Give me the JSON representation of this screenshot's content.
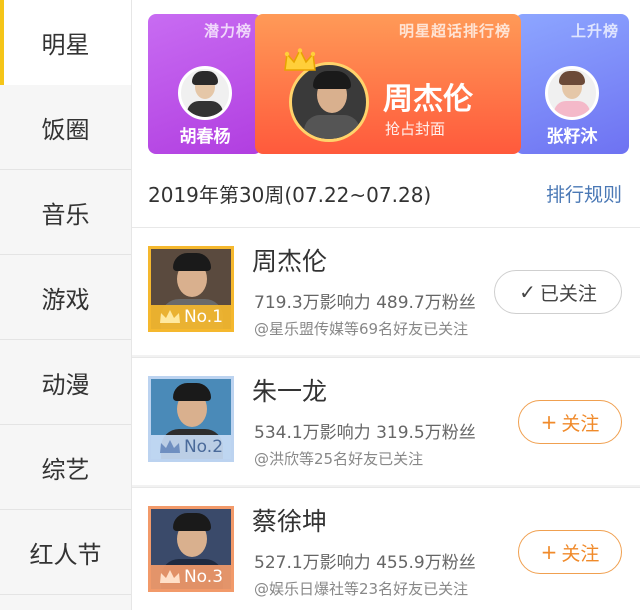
{
  "sidebar": {
    "items": [
      {
        "label": "明星",
        "active": true
      },
      {
        "label": "饭圈",
        "active": false
      },
      {
        "label": "音乐",
        "active": false
      },
      {
        "label": "游戏",
        "active": false
      },
      {
        "label": "动漫",
        "active": false
      },
      {
        "label": "综艺",
        "active": false
      },
      {
        "label": "红人节",
        "active": false
      }
    ]
  },
  "banner": {
    "left": {
      "tag": "潜力榜",
      "name": "胡春杨"
    },
    "center": {
      "tag": "明星超话排行榜",
      "name": "周杰伦",
      "subtitle": "抢占封面"
    },
    "right": {
      "tag": "上升榜",
      "name": "张籽沐"
    }
  },
  "week": {
    "label": "2019年第30周(07.22~07.28)",
    "rules_link": "排行规则"
  },
  "ranking": [
    {
      "rank": "No.1",
      "name": "周杰伦",
      "stats": "719.3万影响力 489.7万粉丝",
      "friends": "@星乐盟传媒等69名好友已关注",
      "button": "已关注",
      "button_glyph": "✓",
      "followed": true
    },
    {
      "rank": "No.2",
      "name": "朱一龙",
      "stats": "534.1万影响力 319.5万粉丝",
      "friends": "@洪欣等25名好友已关注",
      "button": "关注",
      "button_glyph": "+",
      "followed": false
    },
    {
      "rank": "No.3",
      "name": "蔡徐坤",
      "stats": "527.1万影响力 455.9万粉丝",
      "friends": "@娱乐日爆社等23名好友已关注",
      "button": "关注",
      "button_glyph": "+",
      "followed": false
    }
  ],
  "colors": {
    "accent": "#f5c518",
    "link": "#4a78b5",
    "follow": "#f08a2a"
  }
}
